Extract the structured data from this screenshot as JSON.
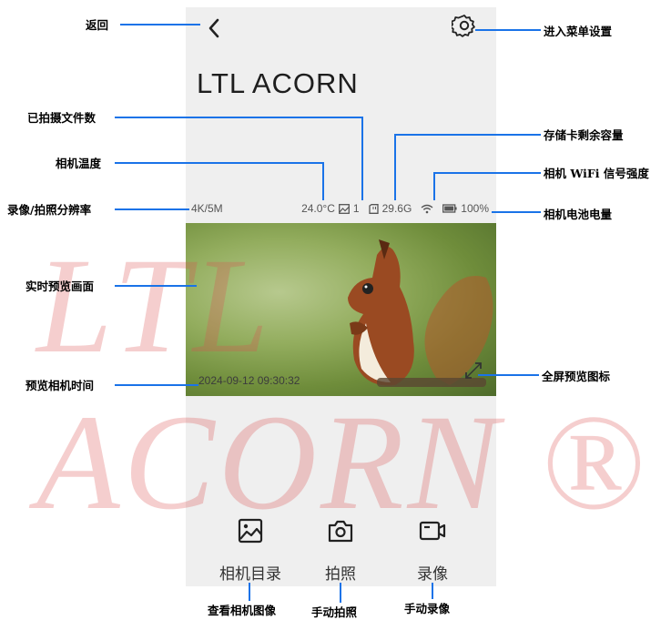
{
  "app": {
    "title": "LTL ACORN"
  },
  "status": {
    "resolution": "4K/5M",
    "temperature": "24.0°C",
    "photo_count": "1",
    "storage": "29.6G",
    "battery": "100%"
  },
  "preview": {
    "timestamp": "2024-09-12 09:30:32"
  },
  "buttons": {
    "album": "相机目录",
    "photo": "拍照",
    "video": "录像"
  },
  "annotations": {
    "back": "返回",
    "settings": "进入菜单设置",
    "files": "已拍摄文件数",
    "storage": "存储卡剩余容量",
    "temperature": "相机温度",
    "wifi": "相机 WiFi 信号强度",
    "resolution": "录像/拍照分辨率",
    "battery": "相机电池电量",
    "preview": "实时预览画面",
    "fullscreen": "全屏预览图标",
    "preview_time": "预览相机时间",
    "album": "查看相机图像",
    "photo": "手动拍照",
    "video": "手动录像"
  },
  "watermark": "LTL ACORN ®",
  "colors": {
    "leader_line": "#1a73e8",
    "phone_bg": "#efefef",
    "watermark": "#dc5050"
  }
}
